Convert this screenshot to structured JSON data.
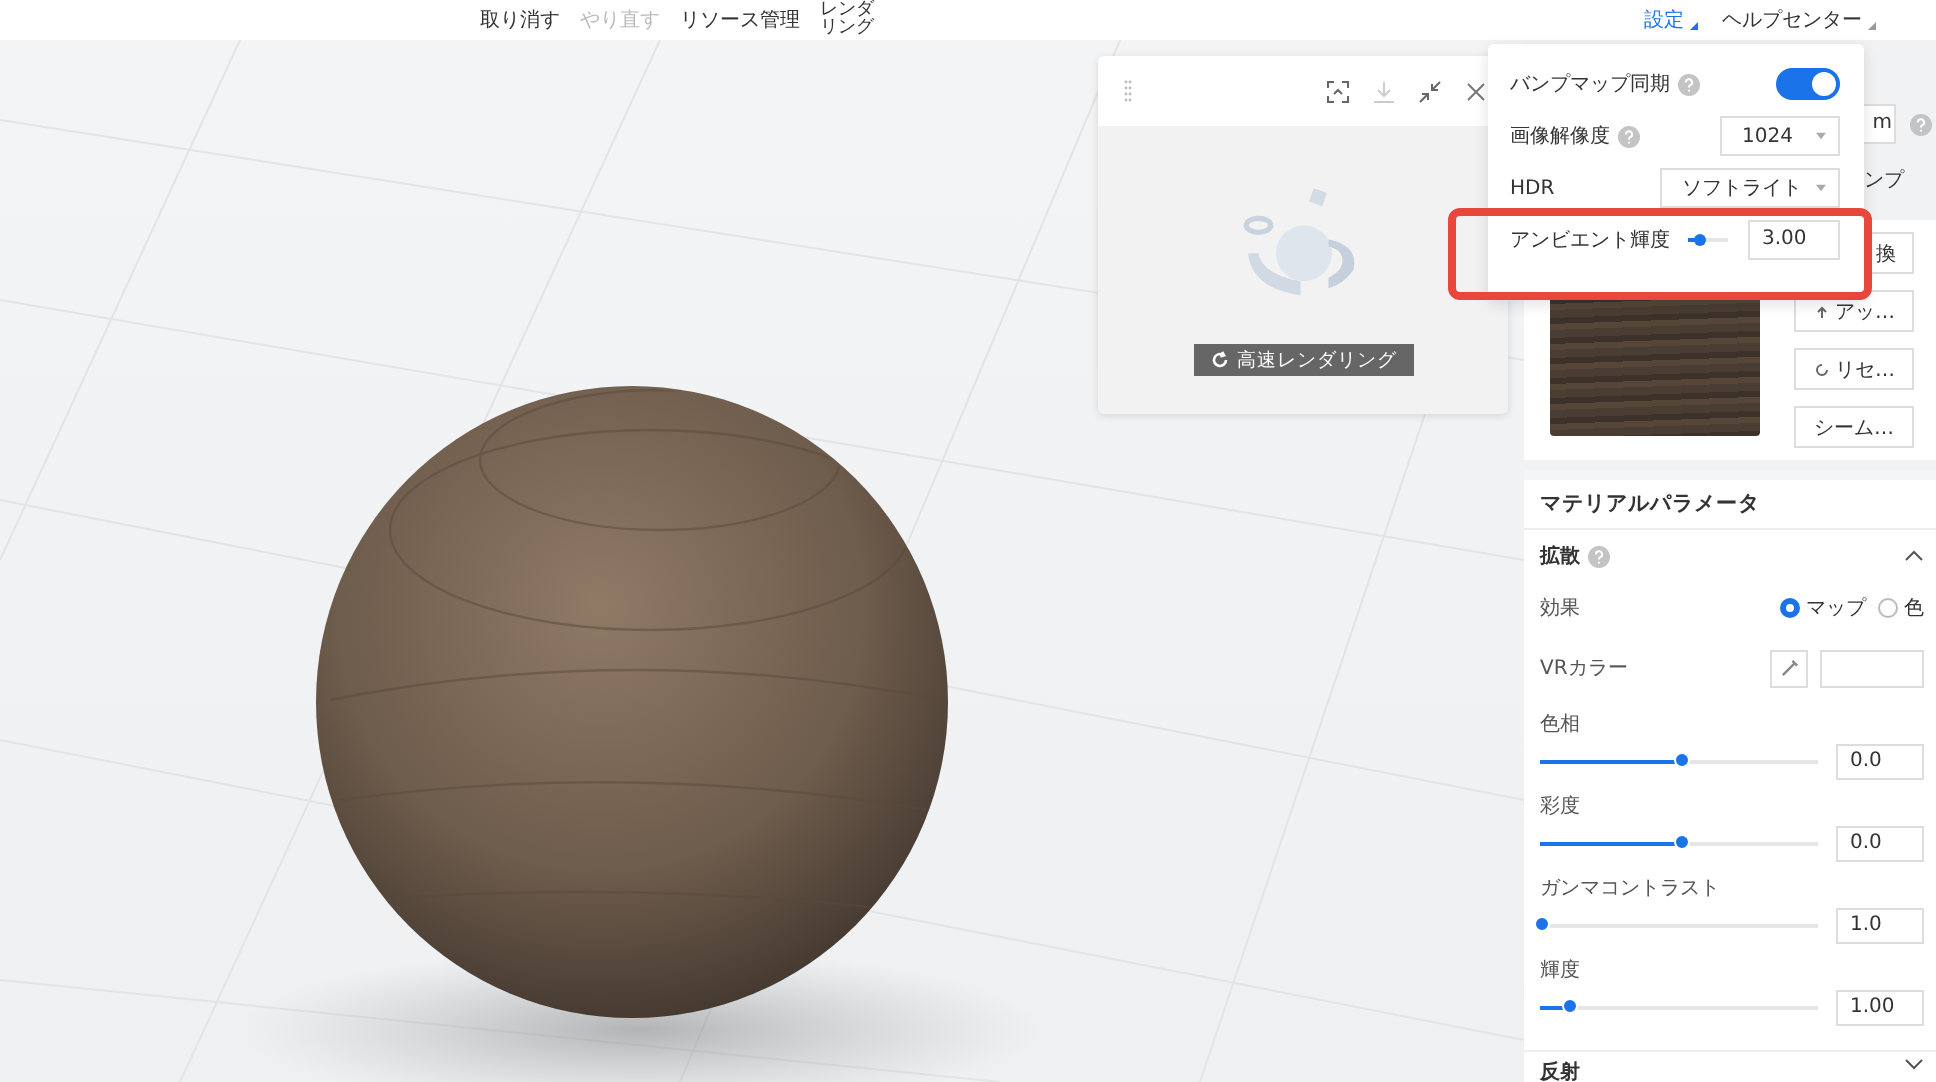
{
  "menu": [
    {
      "label": "取り消す",
      "disabled": false
    },
    {
      "label": "やり直す",
      "disabled": true
    },
    {
      "label": "リソース管理",
      "disabled": false
    },
    {
      "label": "レンダリング",
      "disabled": false
    }
  ],
  "top_right": [
    {
      "label": "設定",
      "selected": true
    },
    {
      "label": "ヘルプセンター",
      "selected": false
    }
  ],
  "render_panel": {
    "button": "高速レンダリング"
  },
  "settings_popup": {
    "bump_sync": {
      "label": "バンプマップ同期",
      "on": true
    },
    "resolution": {
      "label": "画像解像度",
      "value": "1024"
    },
    "hdr": {
      "label": "HDR",
      "value": "ソフトライト"
    },
    "ambient": {
      "label": "アンビエント輝度",
      "level": 0.3,
      "value": "3.00"
    },
    "highlighted": true
  },
  "right_panel": {
    "size_field": "m",
    "tab": "ンプ",
    "texture_buttons": [
      {
        "label": "換",
        "kind": "plain"
      },
      {
        "label": "アッ…",
        "kind": "upload"
      },
      {
        "label": "リセ…",
        "kind": "reset"
      },
      {
        "label": "シーム…",
        "kind": "plain"
      }
    ]
  },
  "material": {
    "title": "マテリアルパラメータ",
    "section": {
      "title": "拡散",
      "expanded": true
    },
    "effect": {
      "label": "効果",
      "options": [
        {
          "label": "マップ",
          "selected": true
        },
        {
          "label": "色",
          "selected": false
        }
      ]
    },
    "vr_color": {
      "label": "VRカラー"
    },
    "sliders": [
      {
        "label": "色相",
        "level": 0.5,
        "value": "0.0"
      },
      {
        "label": "彩度",
        "level": 0.5,
        "value": "0.0"
      },
      {
        "label": "ガンマコントラスト",
        "level": 0.0,
        "value": "1.0"
      },
      {
        "label": "輝度",
        "level": 0.1,
        "value": "1.00"
      }
    ],
    "next_section": {
      "title": "反射",
      "expanded": false
    }
  }
}
